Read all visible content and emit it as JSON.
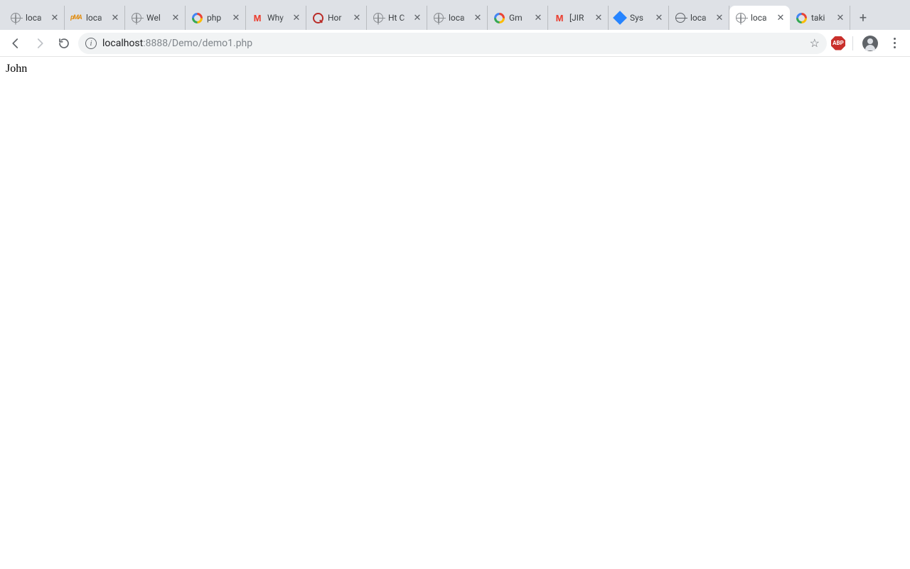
{
  "tabs": [
    {
      "label": "loca",
      "icon": "globe"
    },
    {
      "label": "loca",
      "icon": "pma"
    },
    {
      "label": "Wel",
      "icon": "globe"
    },
    {
      "label": "php",
      "icon": "google"
    },
    {
      "label": "Why",
      "icon": "gmail"
    },
    {
      "label": "Hor",
      "icon": "quora"
    },
    {
      "label": "Ht C",
      "icon": "globe"
    },
    {
      "label": "loca",
      "icon": "globe"
    },
    {
      "label": "Gm",
      "icon": "google"
    },
    {
      "label": "[JIR",
      "icon": "gmail"
    },
    {
      "label": "Sys",
      "icon": "jira"
    },
    {
      "label": "loca",
      "icon": "globe-dark"
    },
    {
      "label": "loca",
      "icon": "globe",
      "active": true
    },
    {
      "label": "taki",
      "icon": "google"
    }
  ],
  "omnibox": {
    "host": "localhost",
    "port": ":8888",
    "path": "/Demo/demo1.php"
  },
  "extensions": {
    "adblock_label": "ABP"
  },
  "page": {
    "body_text": "John"
  }
}
